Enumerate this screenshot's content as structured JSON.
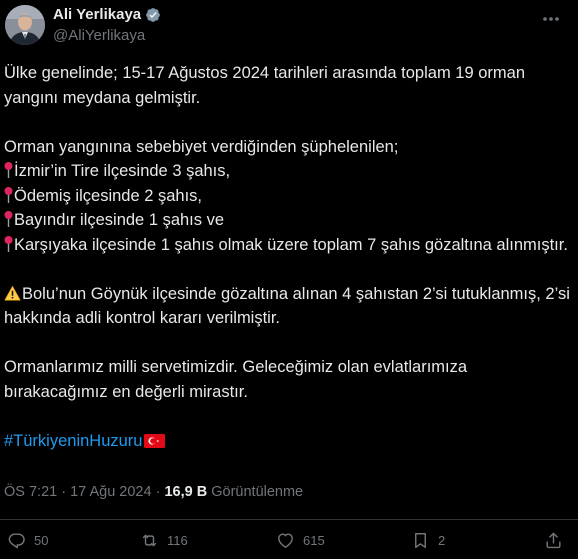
{
  "author": {
    "name": "Ali Yerlikaya",
    "handle": "@AliYerlikaya"
  },
  "tweet": {
    "para1": "Ülke genelinde; 15-17 Ağustos 2024 tarihleri arasında toplam 19 orman yangını meydana gelmiştir.",
    "para2_intro": "Orman yangınına sebebiyet verdiğinden şüphelenilen;",
    "bullets": [
      "İzmir’in Tire ilçesinde 3 şahıs,",
      "Ödemiş ilçesinde 2 şahıs,",
      "Bayındır ilçesinde 1 şahıs ve",
      "Karşıyaka ilçesinde 1 şahıs olmak üzere toplam 7 şahıs gözaltına alınmıştır."
    ],
    "para3": "Bolu’nun Göynük ilçesinde gözaltına alınan 4 şahıstan 2’si tutuklanmış, 2’si hakkında adli kontrol kararı verilmiştir.",
    "para4": "Ormanlarımız milli servetimizdir. Geleceğimiz olan evlatlarımıza bırakacağımız en değerli mirastır.",
    "hashtag": "#TürkiyeninHuzuru"
  },
  "meta": {
    "time": "ÖS 7:21",
    "separator": "·",
    "date": "17 Ağu 2024",
    "views_count": "16,9 B",
    "views_label": "Görüntülenme"
  },
  "actions": {
    "replies": "50",
    "reposts": "116",
    "likes": "615",
    "bookmarks": "2"
  },
  "colors": {
    "background": "#000000",
    "text": "#e7e9ea",
    "muted": "#71767b",
    "link": "#1d9bf0",
    "verified": "#829aab"
  }
}
